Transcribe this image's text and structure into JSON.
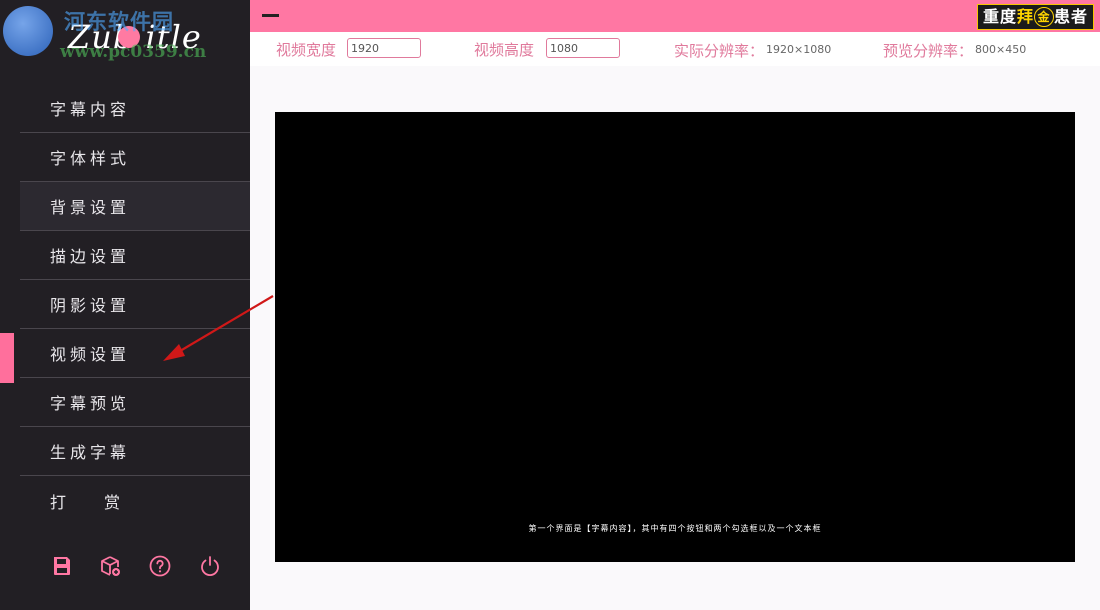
{
  "app": {
    "logo_text": "Zub  itle",
    "watermark_site": "河东软件园",
    "watermark_url": "www.pc0359.cn",
    "watermark_top": {
      "part1": "重度",
      "part2": "拜",
      "part3": "金",
      "part4": "患者"
    }
  },
  "sidebar": {
    "items": [
      {
        "label": "字幕内容"
      },
      {
        "label": "字体样式"
      },
      {
        "label": "背景设置"
      },
      {
        "label": "描边设置"
      },
      {
        "label": "阴影设置"
      },
      {
        "label": "视频设置"
      },
      {
        "label": "字幕预览"
      },
      {
        "label": "生成字幕"
      },
      {
        "label": "打赏"
      }
    ],
    "active_index": 5,
    "tools": [
      "save-icon",
      "package-icon",
      "help-icon",
      "power-icon"
    ]
  },
  "settings": {
    "width_label": "视频宽度",
    "width_value": "1920",
    "height_label": "视频高度",
    "height_value": "1080",
    "actual_label": "实际分辨率：",
    "actual_value": "1920×1080",
    "preview_label": "预览分辨率：",
    "preview_value": "800×450"
  },
  "preview": {
    "caption": "第一个界面是【字幕内容】，其中有四个按钮和两个勾选框以及一个文本框"
  },
  "colors": {
    "accent": "#ff77a3",
    "sidebar_bg": "#221f24",
    "label_pink": "#e07a9c"
  }
}
